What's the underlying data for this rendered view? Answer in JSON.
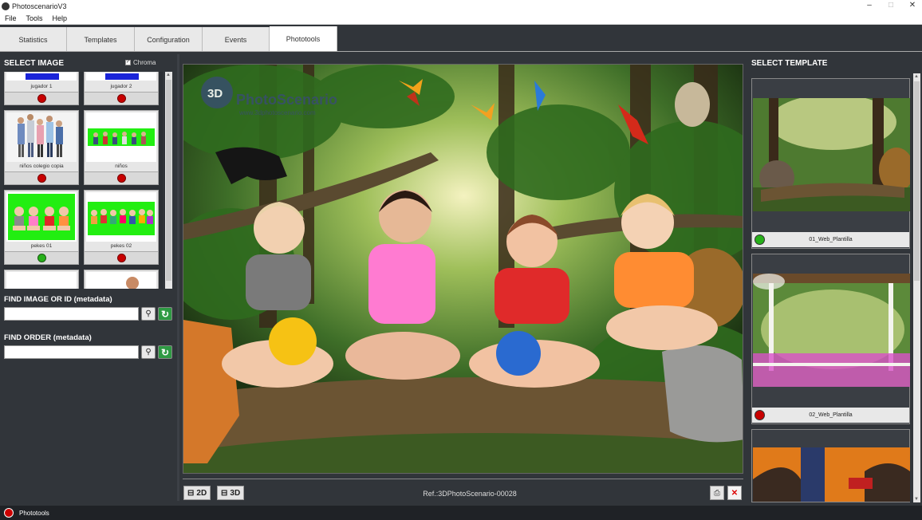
{
  "window": {
    "title": "PhotoscenarioV3"
  },
  "menu": [
    "File",
    "Tools",
    "Help"
  ],
  "tabs": [
    "Statistics",
    "Templates",
    "Configuration",
    "Events",
    "Phototools"
  ],
  "active_tab": "Phototools",
  "left": {
    "title": "SELECT IMAGE",
    "chroma_label": "Chroma",
    "chroma_checked": true,
    "images": [
      {
        "label": "jugador 1",
        "status": "red"
      },
      {
        "label": "jugador 2",
        "status": "red"
      },
      {
        "label": "niños colegio copia",
        "status": "red"
      },
      {
        "label": "niños",
        "status": "red"
      },
      {
        "label": "pekes 01",
        "status": "green"
      },
      {
        "label": "pekes 02",
        "status": "red"
      }
    ],
    "find_image_label": "FIND IMAGE OR ID (metadata)",
    "find_order_label": "FIND ORDER (metadata)",
    "find_image_value": "",
    "find_order_value": ""
  },
  "center": {
    "watermark_main": "PhotoScenario",
    "watermark_sub": "www.3dphotoscenario.com",
    "btn_2d": "2D",
    "btn_3d": "3D",
    "ref": "Ref.:3DPhotoScenario-00028"
  },
  "right": {
    "title": "SELECT TEMPLATE",
    "templates": [
      {
        "name": "01_Web_Plantilla",
        "status": "green"
      },
      {
        "name": "02_Web_Plantilla",
        "status": "red"
      }
    ]
  },
  "status": {
    "label": "Phototools"
  },
  "colors": {
    "green": "#27b01a",
    "red": "#c80000",
    "chroma_green": "#22ee11",
    "bg": "#31353a"
  }
}
